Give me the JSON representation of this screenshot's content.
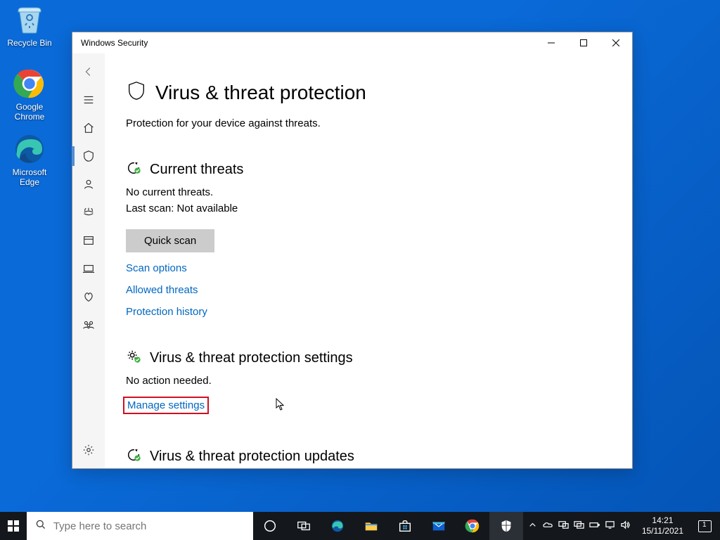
{
  "desktop": {
    "recycle_label": "Recycle Bin",
    "chrome_label": "Google\nChrome",
    "edge_label": "Microsoft\nEdge"
  },
  "window": {
    "title": "Windows Security",
    "page_title": "Virus & threat protection",
    "page_subtitle": "Protection for your device against threats.",
    "current_threats": {
      "title": "Current threats",
      "line1": "No current threats.",
      "line2": "Last scan: Not available",
      "quick_scan_label": "Quick scan",
      "scan_options_label": "Scan options",
      "allowed_threats_label": "Allowed threats",
      "protection_history_label": "Protection history"
    },
    "settings_section": {
      "title": "Virus & threat protection settings",
      "status": "No action needed.",
      "manage_link": "Manage settings"
    },
    "updates_section": {
      "title": "Virus & threat protection updates"
    }
  },
  "taskbar": {
    "search_placeholder": "Type here to search",
    "clock_time": "14:21",
    "clock_date": "15/11/2021",
    "notif_count": "1"
  }
}
